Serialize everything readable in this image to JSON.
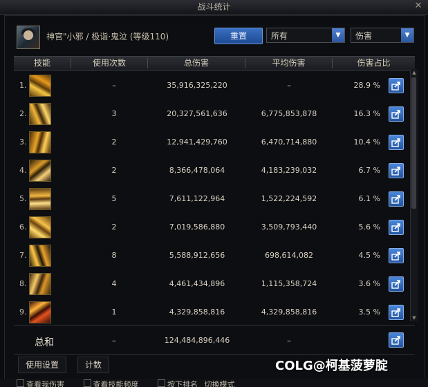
{
  "window": {
    "title": "战斗统计"
  },
  "header": {
    "character": "神官\"小邪 / 极诣·鬼泣 (等级110)",
    "reset_label": "重置",
    "filter_select": "所有",
    "mode_select": "伤害"
  },
  "table": {
    "columns": [
      "技能",
      "使用次数",
      "总伤害",
      "平均伤害",
      "伤害占比"
    ],
    "rows": [
      {
        "rank": "1.",
        "count": "–",
        "total": "35,916,325,220",
        "avg": "–",
        "pct": "28.9 %",
        "icon": "skill-icon-1"
      },
      {
        "rank": "2.",
        "count": "3",
        "total": "20,327,561,636",
        "avg": "6,775,853,878",
        "pct": "16.3 %",
        "icon": "skill-icon-2"
      },
      {
        "rank": "3.",
        "count": "2",
        "total": "12,941,429,760",
        "avg": "6,470,714,880",
        "pct": "10.4 %",
        "icon": "skill-icon-3"
      },
      {
        "rank": "4.",
        "count": "2",
        "total": "8,366,478,064",
        "avg": "4,183,239,032",
        "pct": "6.7 %",
        "icon": "skill-icon-4"
      },
      {
        "rank": "5.",
        "count": "5",
        "total": "7,611,122,964",
        "avg": "1,522,224,592",
        "pct": "6.1 %",
        "icon": "skill-icon-5"
      },
      {
        "rank": "6.",
        "count": "2",
        "total": "7,019,586,880",
        "avg": "3,509,793,440",
        "pct": "5.6 %",
        "icon": "skill-icon-6"
      },
      {
        "rank": "7.",
        "count": "8",
        "total": "5,588,912,656",
        "avg": "698,614,082",
        "pct": "4.5 %",
        "icon": "skill-icon-7"
      },
      {
        "rank": "8.",
        "count": "4",
        "total": "4,461,434,896",
        "avg": "1,115,358,724",
        "pct": "3.6 %",
        "icon": "skill-icon-8"
      },
      {
        "rank": "9.",
        "count": "1",
        "total": "4,329,858,816",
        "avg": "4,329,858,816",
        "pct": "3.5 %",
        "icon": "skill-icon-9"
      }
    ]
  },
  "total": {
    "label": "总和",
    "count": "–",
    "total": "124,484,896,446",
    "avg": "–"
  },
  "footer": {
    "tab_settings": "使用设置",
    "tab_count": "计数"
  },
  "bottom": {
    "opt1": "查看我伤害",
    "opt2": "查看技能频度",
    "opt3": "按下排名",
    "opt4": "切换模式"
  },
  "watermark": {
    "brand": "COLG",
    "handle": "@柯基菠萝腚"
  },
  "colors": {
    "accent_blue": "#2f63b4",
    "gold": "#d9a43a"
  }
}
